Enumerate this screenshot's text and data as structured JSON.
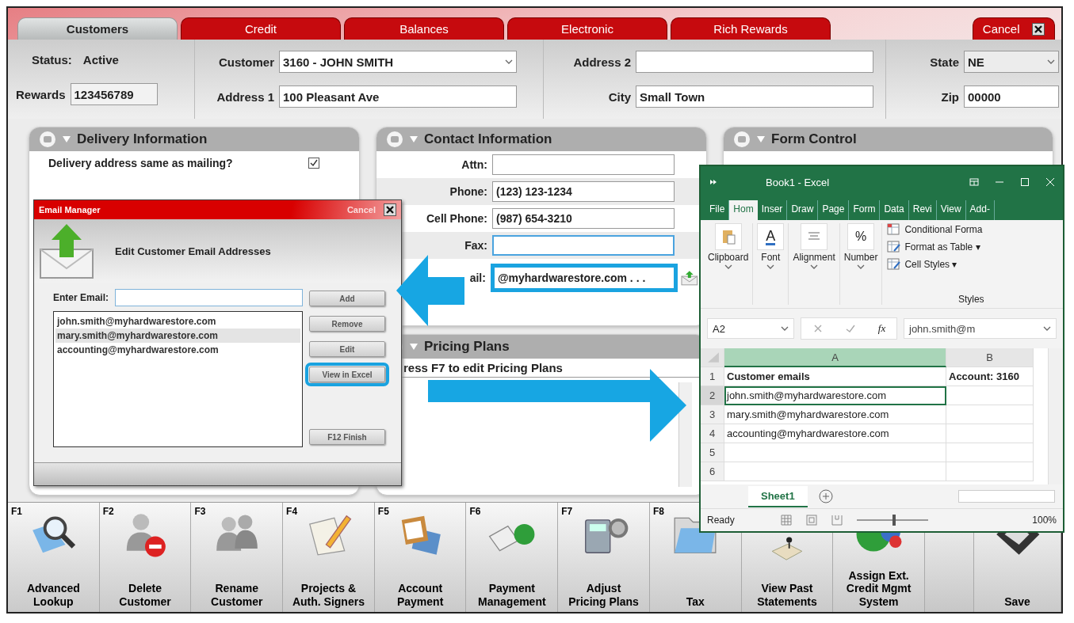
{
  "tabs": [
    {
      "label": "Customers",
      "selected": true
    },
    {
      "label": "Credit",
      "selected": false
    },
    {
      "label": "Balances",
      "selected": false
    },
    {
      "label": "Electronic",
      "selected": false
    },
    {
      "label": "Rich Rewards",
      "selected": false
    }
  ],
  "cancel": "Cancel",
  "header": {
    "status_label": "Status:",
    "status": "Active",
    "rewards_label": "Rewards",
    "rewards": "123456789",
    "customer_label": "Customer",
    "customer": "3160 - JOHN SMITH",
    "address1_label": "Address 1",
    "address1": "100 Pleasant Ave",
    "address2_label": "Address 2",
    "city_label": "City",
    "city": "Small Town",
    "state_label": "State",
    "state": "NE",
    "zip_label": "Zip",
    "zip": "00000"
  },
  "delivery": {
    "title": "Delivery Information",
    "same_label": "Delivery address same as mailing?",
    "same_checked": true
  },
  "contact": {
    "title": "Contact Information",
    "fields": [
      {
        "label": "Attn:",
        "focused": false,
        "highlighted": false
      },
      {
        "label": "Phone:",
        "value": "(123) 123-1234",
        "focused": false,
        "highlighted": false
      },
      {
        "label": "Cell Phone:",
        "value": "(987) 654-3210",
        "focused": false,
        "highlighted": false
      },
      {
        "label": "Fax:",
        "focused": true,
        "highlighted": false
      },
      {
        "label": "ail:",
        "value": "@myhardwarestore.com . . .",
        "focused": false,
        "highlighted": true
      }
    ]
  },
  "pricing": {
    "title": "Pricing Plans",
    "hint": "ress F7 to edit Pricing Plans"
  },
  "form_control": {
    "title": "Form Control"
  },
  "toolbar": [
    {
      "key": "F1",
      "label": "Advanced\nLookup"
    },
    {
      "key": "F2",
      "label": "Delete\nCustomer"
    },
    {
      "key": "F3",
      "label": "Rename\nCustomer"
    },
    {
      "key": "F4",
      "label": "Projects &\nAuth. Signers"
    },
    {
      "key": "F5",
      "label": "Account\nPayment"
    },
    {
      "key": "F6",
      "label": "Payment\nManagement"
    },
    {
      "key": "F7",
      "label": "Adjust\nPricing Plans"
    },
    {
      "key": "F8",
      "label": "Tax"
    },
    {
      "label": "View Past\nStatements"
    },
    {
      "label": "Assign Ext.\nCredit Mgmt\nSystem"
    },
    {
      "label": "Save"
    }
  ],
  "email_manager": {
    "title": "Email Manager",
    "cancel": "Cancel",
    "heading": "Edit Customer Email Addresses",
    "enter_label": "Enter Email:",
    "emails": [
      {
        "text": "john.smith@myhardwarestore.com",
        "selected": false
      },
      {
        "text": "mary.smith@myhardwarestore.com",
        "selected": true
      },
      {
        "text": "accounting@myhardwarestore.com",
        "selected": false
      }
    ],
    "buttons": [
      {
        "label": "Add",
        "highlighted": false
      },
      {
        "label": "Remove",
        "highlighted": false
      },
      {
        "label": "Edit",
        "highlighted": false
      },
      {
        "label": "View in Excel",
        "highlighted": true
      },
      {
        "label": "F12  Finish",
        "highlighted": false
      }
    ]
  },
  "excel": {
    "title": "Book1  -  Excel",
    "ribbon_tabs": [
      {
        "label": "File",
        "selected": false
      },
      {
        "label": "Hom",
        "selected": true
      },
      {
        "label": "Inser",
        "selected": false
      },
      {
        "label": "Draw",
        "selected": false
      },
      {
        "label": "Page",
        "selected": false
      },
      {
        "label": "Form",
        "selected": false
      },
      {
        "label": "Data",
        "selected": false
      },
      {
        "label": "Revi",
        "selected": false
      },
      {
        "label": "View",
        "selected": false
      },
      {
        "label": "Add-",
        "selected": false
      }
    ],
    "groups": [
      {
        "label": "Clipboard"
      },
      {
        "label": "Font",
        "glyph": "A"
      },
      {
        "label": "Alignment"
      },
      {
        "label": "Number",
        "glyph": "%"
      }
    ],
    "styles": [
      "Conditional Forma",
      "Format as Table ▾",
      "Cell Styles ▾"
    ],
    "styles_label": "Styles",
    "name_box": "A2",
    "function_label": "fx",
    "formula": "john.smith@m",
    "columns": [
      {
        "label": "A",
        "selected": true
      },
      {
        "label": "B",
        "selected": false
      }
    ],
    "rows": [
      {
        "num": "1",
        "cells": [
          "Customer emails",
          "Account: 3160"
        ],
        "bold": true,
        "selected": false
      },
      {
        "num": "2",
        "cells": [
          "john.smith@myhardwarestore.com"
        ],
        "selected": true
      },
      {
        "num": "3",
        "cells": [
          "mary.smith@myhardwarestore.com"
        ],
        "selected": false
      },
      {
        "num": "4",
        "cells": [
          "accounting@myhardwarestore.com"
        ],
        "selected": false
      },
      {
        "num": "5",
        "cells": [],
        "selected": false
      },
      {
        "num": "6",
        "cells": [],
        "selected": false
      }
    ],
    "sheet_tab": "Sheet1",
    "status": "Ready",
    "zoom": "100%",
    "zoom_slider": {
      "level": 0.5
    }
  }
}
